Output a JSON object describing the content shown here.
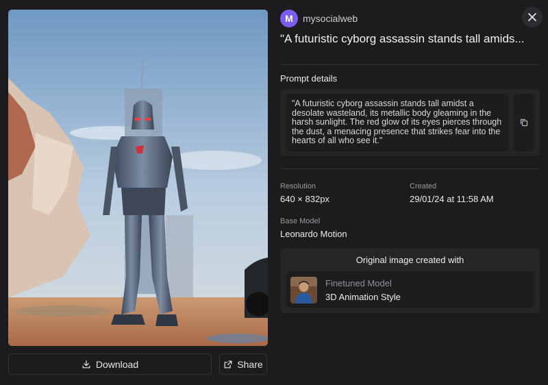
{
  "user": {
    "avatar_letter": "M",
    "username": "mysocialweb"
  },
  "title": "\"A futuristic cyborg assassin stands tall amids...",
  "prompt": {
    "label": "Prompt details",
    "text": "\"A futuristic cyborg assassin stands tall amidst a desolate wasteland, its metallic body gleaming in the harsh sunlight. The red glow of its eyes pierces through the dust, a menacing presence that strikes fear into the hearts of all who see it.\""
  },
  "details": {
    "resolution_label": "Resolution",
    "resolution_value": "640 × 832px",
    "created_label": "Created",
    "created_value": "29/01/24 at 11:58 AM",
    "base_model_label": "Base Model",
    "base_model_value": "Leonardo Motion"
  },
  "origin": {
    "heading": "Original image created with",
    "model_type": "Finetuned Model",
    "model_name": "3D Animation Style"
  },
  "actions": {
    "download_label": "Download",
    "share_label": "Share"
  },
  "icons": {
    "close": "close-icon",
    "copy": "copy-icon",
    "download": "download-icon",
    "share": "share-icon"
  },
  "colors": {
    "background": "#1c1c1e",
    "avatar": "#7b5cf0",
    "panel": "#252528"
  }
}
